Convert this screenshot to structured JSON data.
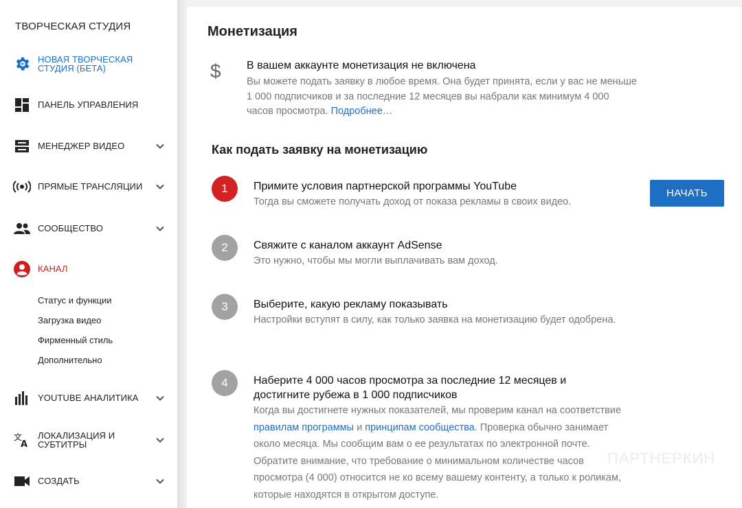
{
  "sidebar": {
    "title": "ТВОРЧЕСКАЯ СТУДИЯ",
    "items": [
      {
        "label_line1": "НОВАЯ ТВОРЧЕСКАЯ",
        "label_line2": "СТУДИЯ (БЕТА)",
        "icon": "gear-icon"
      },
      {
        "label": "ПАНЕЛЬ УПРАВЛЕНИЯ",
        "icon": "dashboard-icon"
      },
      {
        "label": "МЕНЕДЖЕР ВИДЕО",
        "icon": "video-manager-icon"
      },
      {
        "label": "ПРЯМЫЕ ТРАНСЛЯЦИИ",
        "icon": "live-broadcast-icon"
      },
      {
        "label": "СООБЩЕСТВО",
        "icon": "community-icon"
      },
      {
        "label": "КАНАЛ",
        "icon": "account-icon"
      },
      {
        "label": "YOUTUBE АНАЛИТИКА",
        "icon": "analytics-icon"
      },
      {
        "label_line1": "ЛОКАЛИЗАЦИЯ И",
        "label_line2": "СУБТИТРЫ",
        "icon": "translate-icon"
      },
      {
        "label": "СОЗДАТЬ",
        "icon": "video-camera-icon"
      }
    ],
    "channel_subitems": [
      "Статус и функции",
      "Загрузка видео",
      "Фирменный стиль",
      "Дополнительно"
    ]
  },
  "main": {
    "title": "Монетизация",
    "notice": {
      "icon": "dollar-icon",
      "title": "В вашем аккаунте монетизация не включена",
      "text": "Вы можете подать заявку в любое время. Она будет принята, если у вас не меньше 1 000 подписчиков и за последние 12 месяцев вы набрали как минимум 4 000 часов просмотра.",
      "link": "Подробнее…"
    },
    "how_title": "Как подать заявку на монетизацию",
    "steps": [
      {
        "num": "1",
        "title": "Примите условия партнерской программы YouTube",
        "desc": "Тогда вы сможете получать доход от показа рекламы в своих видео."
      },
      {
        "num": "2",
        "title": "Свяжите с каналом аккаунт AdSense",
        "desc": "Это нужно, чтобы мы могли выплачивать вам доход."
      },
      {
        "num": "3",
        "title": "Выберите, какую рекламу показывать",
        "desc": "Настройки вступят в силу, как только заявка на монетизацию будет одобрена."
      },
      {
        "num": "4",
        "title": "Наберите 4 000 часов просмотра за последние 12 месяцев и достигните рубежа в 1 000 подписчиков",
        "desc_part1": "Когда вы достигнете нужных показателей, мы проверим канал на соответствие ",
        "link1": "правилам программы",
        "desc_and": " и ",
        "link2": "принципам сообщества",
        "desc_part2": ". Проверка обычно занимает около месяца. Мы сообщим вам о ее результатах по электронной почте. Обратите внимание, что требование о минимальном количестве часов просмотра (4 000) относится не ко всему вашему контенту, а только к роликам, которые находятся в открытом доступе."
      }
    ],
    "start_button": "НАЧАТЬ"
  },
  "watermark": "ПАРТНЕРКИН",
  "colors": {
    "accent": "#1e6fc4",
    "active_step": "#d32222",
    "channel": "#cc1f1f",
    "inactive_step": "#a2a2a2"
  }
}
